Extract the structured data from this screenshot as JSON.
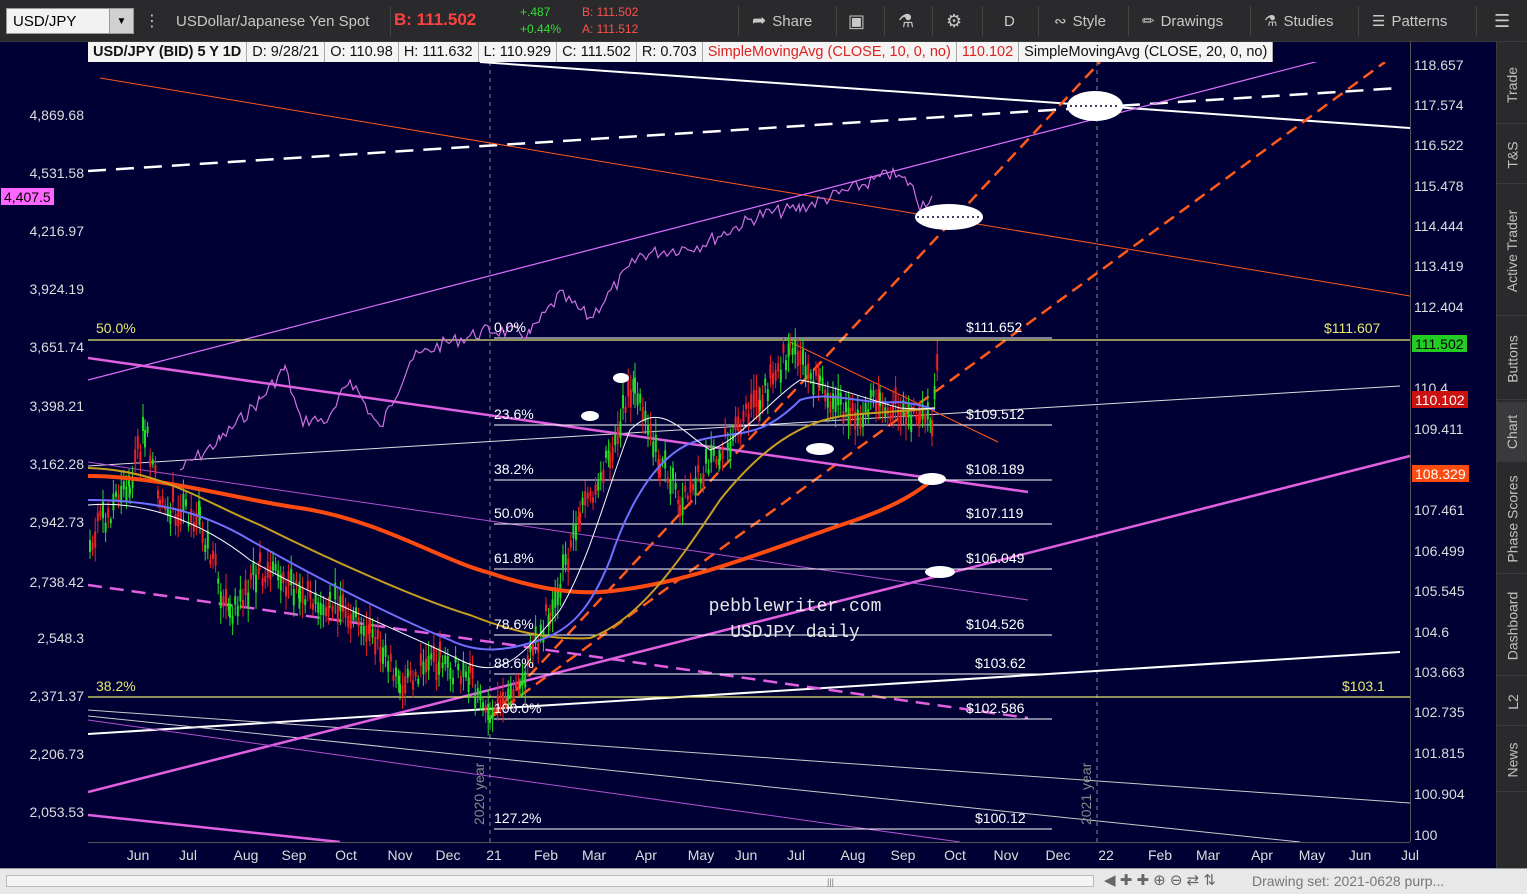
{
  "toolbar": {
    "symbol": "USD/JPY",
    "description": "USDollar/Japanese Yen Spot",
    "bid_label": "B: 111.502",
    "change": "+.487",
    "change_pct": "+0.44%",
    "bid_small": "B: 111.502",
    "ask_small": "A: 111.512",
    "share": "Share",
    "period": "D",
    "style": "Style",
    "drawings": "Drawings",
    "studies": "Studies",
    "patterns": "Patterns"
  },
  "infobar": {
    "title": "USD/JPY (BID) 5 Y 1D",
    "date": "D: 9/28/21",
    "open": "O: 110.98",
    "high": "H: 111.632",
    "low": "L: 110.929",
    "close": "C: 111.502",
    "range": "R: 0.703",
    "sma10": "SimpleMovingAvg (CLOSE, 10, 0, no)",
    "sma10_val": "110.102",
    "sma20": "SimpleMovingAvg (CLOSE, 20, 0, no)"
  },
  "sidebar_tabs": [
    "Trade",
    "T&S",
    "Active Trader",
    "Buttons",
    "Chart",
    "Phase Scores",
    "Dashboard",
    "L2",
    "News"
  ],
  "left_axis": [
    "4,869.68",
    "4,531.58",
    "4,216.97",
    "3,924.19",
    "3,651.74",
    "3,398.21",
    "3,162.28",
    "2,942.73",
    "2,738.42",
    "2,548.3",
    "2,371.37",
    "2,206.73",
    "2,053.53"
  ],
  "left_tag": "4,407.5",
  "right_axis": [
    "118.657",
    "117.574",
    "116.522",
    "115.478",
    "114.444",
    "113.419",
    "112.404",
    "111.50",
    "110.4",
    "109.411",
    "108.32",
    "107.461",
    "106.499",
    "105.545",
    "104.6",
    "103.663",
    "102.735",
    "101.815",
    "100.904",
    "100"
  ],
  "right_tags": {
    "last": "111.502",
    "sma10": "110.102",
    "sma20": "108.329"
  },
  "x_axis": [
    "Jun",
    "Jul",
    "Aug",
    "Sep",
    "Oct",
    "Nov",
    "Dec",
    "21",
    "Feb",
    "Mar",
    "Apr",
    "May",
    "Jun",
    "Jul",
    "Aug",
    "Sep",
    "Oct",
    "Nov",
    "Dec",
    "22",
    "Feb",
    "Mar",
    "Apr",
    "May",
    "Jun",
    "Jul"
  ],
  "year_labels": {
    "y2020": "2020 year",
    "y2021": "2021 year"
  },
  "fib": [
    {
      "pct": "0.0%",
      "price": "$111.652"
    },
    {
      "pct": "23.6%",
      "price": "$109.512"
    },
    {
      "pct": "38.2%",
      "price": "$108.189"
    },
    {
      "pct": "50.0%",
      "price": "$107.119"
    },
    {
      "pct": "61.8%",
      "price": "$106.049"
    },
    {
      "pct": "78.6%",
      "price": "$104.526"
    },
    {
      "pct": "88.6%",
      "price": "$103.62"
    },
    {
      "pct": "100.0%",
      "price": "$102.586"
    },
    {
      "pct": "127.2%",
      "price": "$100.12"
    }
  ],
  "yellow_lines": {
    "upper_left": "50.0%",
    "upper_right": "$111.607",
    "lower_left": "38.2%",
    "lower_right": "$103.1"
  },
  "watermark": {
    "line1": "pebblewriter.com",
    "line2": "USDJPY daily"
  },
  "status": "Drawing set: 2021-0628 purp...",
  "colors": {
    "background": "#000034",
    "fib": "#ffffff",
    "yellow": "#e8e870",
    "magenta": "#e060e0",
    "orange": "#ff5020"
  }
}
